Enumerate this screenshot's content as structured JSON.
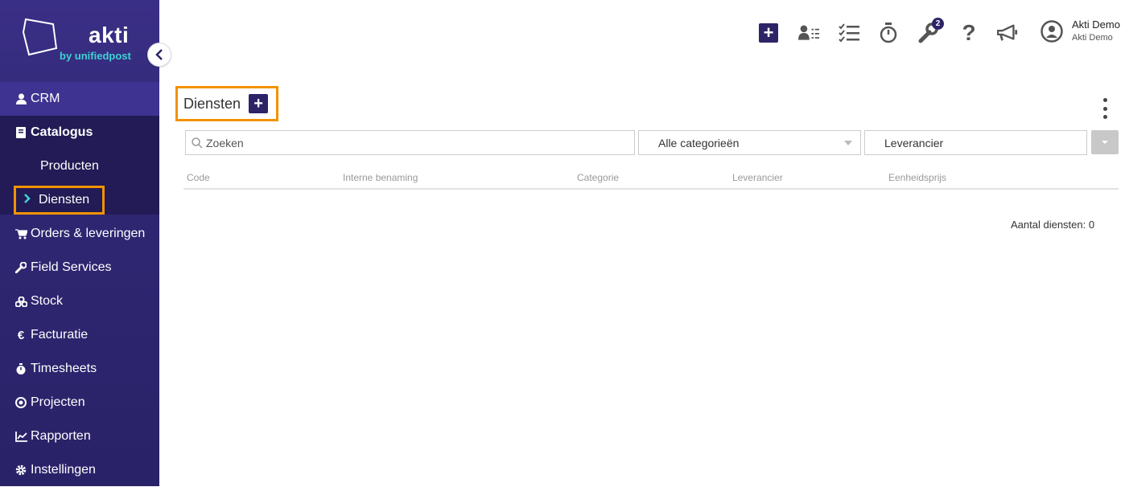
{
  "logo": {
    "word": "akti",
    "sub": "by unifiedpost"
  },
  "sidebar": {
    "items": [
      {
        "label": "CRM",
        "icon": "user-icon"
      },
      {
        "label": "Catalogus",
        "icon": "book-icon"
      },
      {
        "label": "Orders & leveringen",
        "icon": "cart-icon"
      },
      {
        "label": "Field Services",
        "icon": "wrench-icon"
      },
      {
        "label": "Stock",
        "icon": "boxes-icon"
      },
      {
        "label": "Facturatie",
        "icon": "euro-icon"
      },
      {
        "label": "Timesheets",
        "icon": "stopwatch-icon"
      },
      {
        "label": "Projecten",
        "icon": "target-icon"
      },
      {
        "label": "Rapporten",
        "icon": "chart-icon"
      },
      {
        "label": "Instellingen",
        "icon": "gear-icon"
      }
    ],
    "catalog_sub": [
      {
        "label": "Producten"
      },
      {
        "label": "Diensten"
      }
    ]
  },
  "topbar": {
    "notification_badge": "2",
    "user_name": "Akti Demo",
    "user_company": "Akti Demo"
  },
  "main": {
    "title": "Diensten",
    "search_placeholder": "Zoeken",
    "category_selected": "Alle categorieën",
    "supplier_placeholder": "Leverancier",
    "columns": [
      "Code",
      "Interne benaming",
      "Categorie",
      "Leverancier",
      "Eenheidsprijs"
    ],
    "count_label": "Aantal diensten: 0"
  },
  "colors": {
    "brand": "#2c2467",
    "accent": "#3ed3d6",
    "highlight": "#f39200"
  }
}
